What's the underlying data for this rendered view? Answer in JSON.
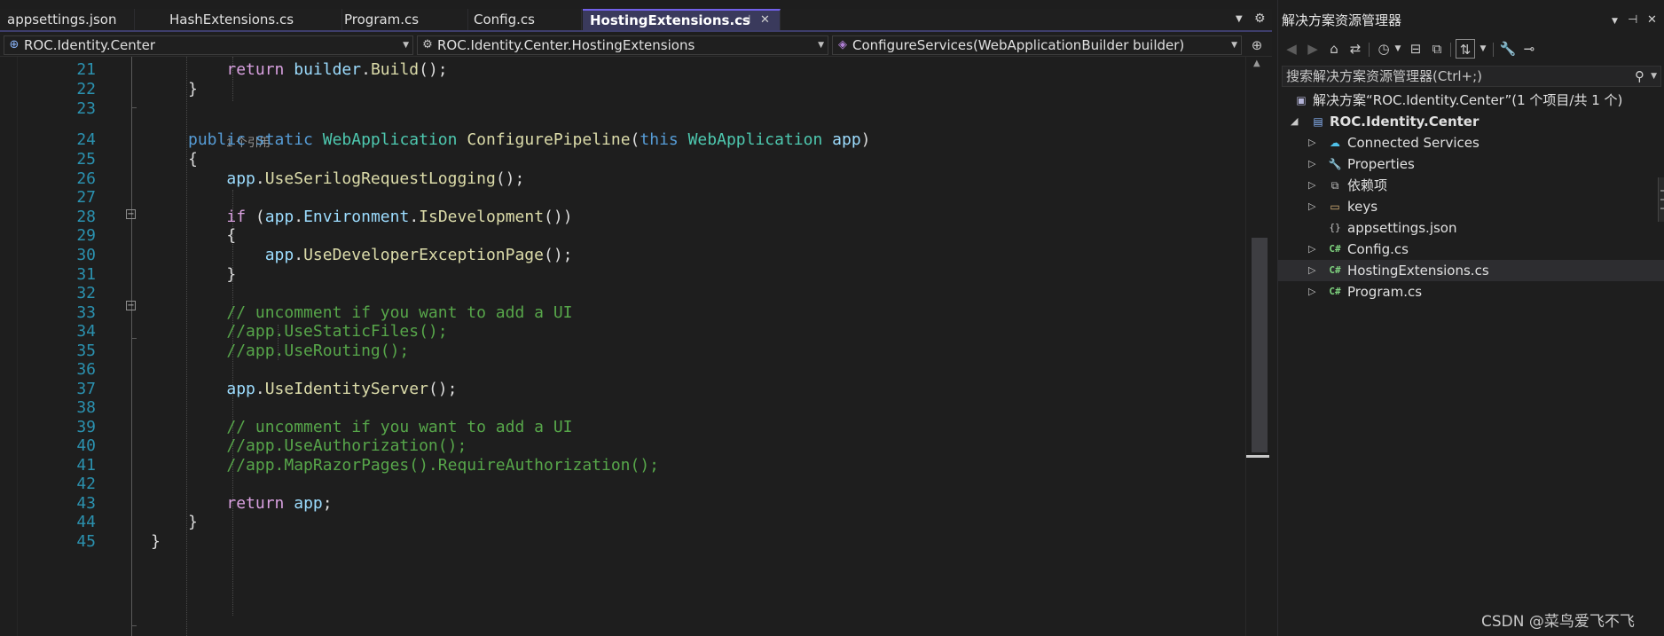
{
  "editor": {
    "tabs": [
      {
        "label": "appsettings.json",
        "active": false
      },
      {
        "label": "HashExtensions.cs",
        "active": false
      },
      {
        "label": "Program.cs",
        "active": false
      },
      {
        "label": "Config.cs",
        "active": false
      },
      {
        "label": "HostingExtensions.cs",
        "active": true
      }
    ],
    "tab_pin_glyph": "⊣",
    "tab_close_glyph": "✕",
    "nav": {
      "project": "ROC.Identity.Center",
      "type": "ROC.Identity.Center.HostingExtensions",
      "member": "ConfigureServices(WebApplicationBuilder builder)"
    },
    "codelens_text": "1 个引用",
    "lines": [
      {
        "n": "21",
        "tokens": [
          [
            "    ",
            "pl"
          ],
          [
            "return",
            "kwc"
          ],
          [
            " ",
            "pl"
          ],
          [
            "builder",
            "pm"
          ],
          [
            ".",
            "pl"
          ],
          [
            "Build",
            "fn"
          ],
          [
            "();",
            "pl"
          ]
        ]
      },
      {
        "n": "22",
        "tokens": [
          [
            "}",
            "pl"
          ]
        ]
      },
      {
        "n": "23",
        "tokens": []
      },
      {
        "n": "24",
        "tokens": [
          [
            "public",
            "kw"
          ],
          [
            " ",
            "pl"
          ],
          [
            "static",
            "kw"
          ],
          [
            " ",
            "pl"
          ],
          [
            "WebApplication",
            "ty"
          ],
          [
            " ",
            "pl"
          ],
          [
            "ConfigurePipeline",
            "fn"
          ],
          [
            "(",
            "pl"
          ],
          [
            "this",
            "kw"
          ],
          [
            " ",
            "pl"
          ],
          [
            "WebApplication",
            "ty"
          ],
          [
            " ",
            "pl"
          ],
          [
            "app",
            "pm"
          ],
          [
            ")",
            "pl"
          ]
        ]
      },
      {
        "n": "25",
        "tokens": [
          [
            "{",
            "pl"
          ]
        ]
      },
      {
        "n": "26",
        "tokens": [
          [
            "    ",
            "pl"
          ],
          [
            "app",
            "pm"
          ],
          [
            ".",
            "pl"
          ],
          [
            "UseSerilogRequestLogging",
            "fn"
          ],
          [
            "();",
            "pl"
          ]
        ]
      },
      {
        "n": "27",
        "tokens": []
      },
      {
        "n": "28",
        "tokens": [
          [
            "    ",
            "pl"
          ],
          [
            "if",
            "kwc"
          ],
          [
            " (",
            "pl"
          ],
          [
            "app",
            "pm"
          ],
          [
            ".",
            "pl"
          ],
          [
            "Environment",
            "pm"
          ],
          [
            ".",
            "pl"
          ],
          [
            "IsDevelopment",
            "fn"
          ],
          [
            "())",
            "pl"
          ]
        ]
      },
      {
        "n": "29",
        "tokens": [
          [
            "    {",
            "pl"
          ]
        ]
      },
      {
        "n": "30",
        "tokens": [
          [
            "        ",
            "pl"
          ],
          [
            "app",
            "pm"
          ],
          [
            ".",
            "pl"
          ],
          [
            "UseDeveloperExceptionPage",
            "fn"
          ],
          [
            "();",
            "pl"
          ]
        ]
      },
      {
        "n": "31",
        "tokens": [
          [
            "    }",
            "pl"
          ]
        ]
      },
      {
        "n": "32",
        "tokens": []
      },
      {
        "n": "33",
        "tokens": [
          [
            "    ",
            "pl"
          ],
          [
            "// uncomment if you want to add a UI",
            "cm"
          ]
        ]
      },
      {
        "n": "34",
        "tokens": [
          [
            "    ",
            "pl"
          ],
          [
            "//app.UseStaticFiles();",
            "cm"
          ]
        ]
      },
      {
        "n": "35",
        "tokens": [
          [
            "    ",
            "pl"
          ],
          [
            "//app.UseRouting();",
            "cm"
          ]
        ]
      },
      {
        "n": "36",
        "tokens": []
      },
      {
        "n": "37",
        "tokens": [
          [
            "    ",
            "pl"
          ],
          [
            "app",
            "pm"
          ],
          [
            ".",
            "pl"
          ],
          [
            "UseIdentityServer",
            "fn"
          ],
          [
            "();",
            "pl"
          ]
        ]
      },
      {
        "n": "38",
        "tokens": []
      },
      {
        "n": "39",
        "tokens": [
          [
            "    ",
            "pl"
          ],
          [
            "// uncomment if you want to add a UI",
            "cm"
          ]
        ]
      },
      {
        "n": "40",
        "tokens": [
          [
            "    ",
            "pl"
          ],
          [
            "//app.UseAuthorization();",
            "cm"
          ]
        ]
      },
      {
        "n": "41",
        "tokens": [
          [
            "    ",
            "pl"
          ],
          [
            "//app.MapRazorPages().RequireAuthorization();",
            "cm"
          ]
        ]
      },
      {
        "n": "42",
        "tokens": []
      },
      {
        "n": "43",
        "tokens": [
          [
            "    ",
            "pl"
          ],
          [
            "return",
            "kwc"
          ],
          [
            " ",
            "pl"
          ],
          [
            "app",
            "pm"
          ],
          [
            ";",
            "pl"
          ]
        ]
      },
      {
        "n": "44",
        "tokens": [
          [
            "}",
            "pl"
          ]
        ]
      },
      {
        "n": "45",
        "tokens": [
          [
            "}",
            "pl"
          ]
        ]
      }
    ]
  },
  "solution_explorer": {
    "title": "解决方案资源管理器",
    "search_placeholder": "搜索解决方案资源管理器(Ctrl+;)",
    "solution_label": "解决方案“ROC.Identity.Center”(1 个项目/共 1 个)",
    "project_label": "ROC.Identity.Center",
    "items": [
      {
        "label": "Connected Services",
        "icon": "connected-services-icon",
        "expandable": true
      },
      {
        "label": "Properties",
        "icon": "properties-icon",
        "expandable": true
      },
      {
        "label": "依赖项",
        "icon": "dependencies-icon",
        "expandable": true
      },
      {
        "label": "keys",
        "icon": "folder-icon",
        "expandable": true
      },
      {
        "label": "appsettings.json",
        "icon": "json-file-icon",
        "expandable": false
      },
      {
        "label": "Config.cs",
        "icon": "csharp-file-icon",
        "expandable": true
      },
      {
        "label": "HostingExtensions.cs",
        "icon": "csharp-file-icon",
        "expandable": true,
        "selected": true
      },
      {
        "label": "Program.cs",
        "icon": "csharp-file-icon",
        "expandable": true
      }
    ]
  },
  "watermark": "CSDN @菜鸟爱飞不飞",
  "colors": {
    "keyword": "#569cd6",
    "control_keyword": "#d8a0df",
    "type": "#4ec9b0",
    "method": "#dcdcaa",
    "identifier": "#9cdcfe",
    "comment": "#57a64a",
    "line_number": "#2b91af",
    "active_tab_accent": "#7160e8"
  }
}
